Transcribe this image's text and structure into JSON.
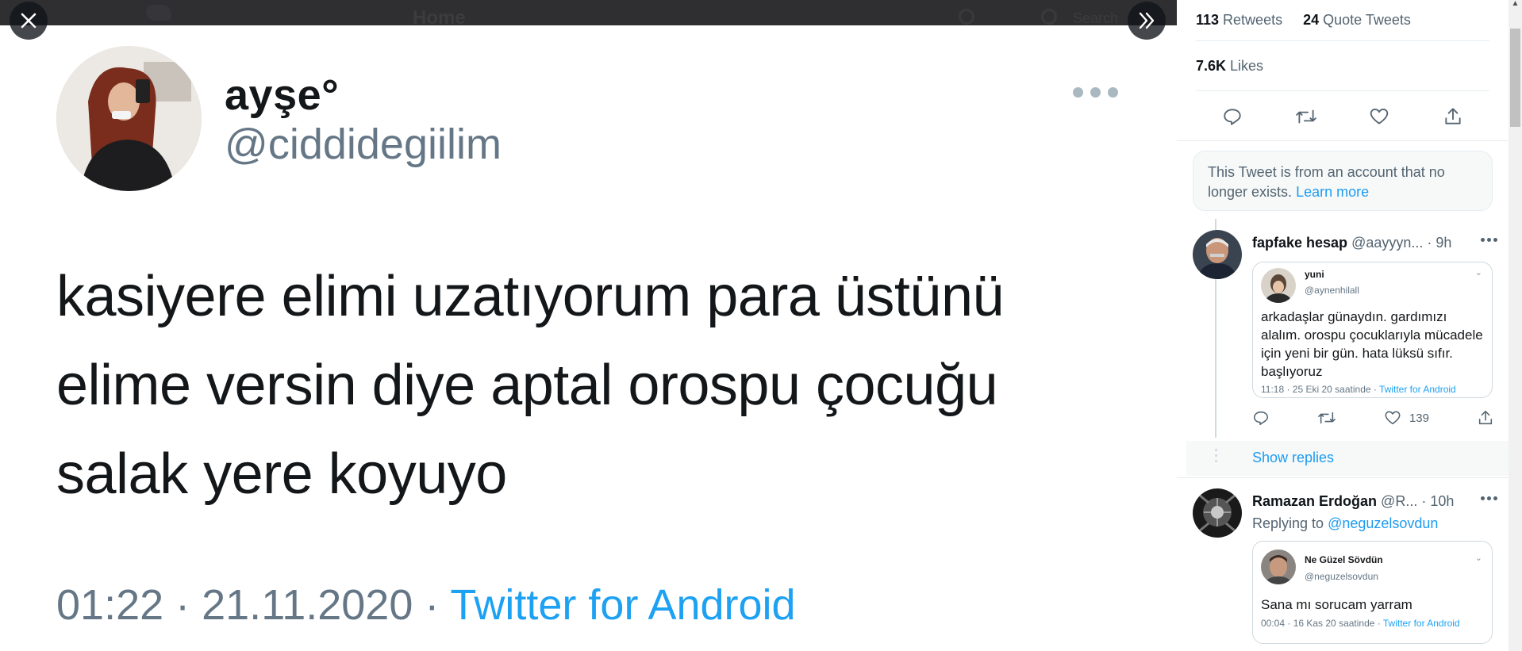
{
  "viewer": {
    "topbar_title": "Home",
    "topbar_search": "Search",
    "author_name": "ayşe°",
    "author_handle": "@ciddidegiilim",
    "tweet_lines": [
      "kasiyere elimi uzatıyorum para üstünü",
      "elime versin diye aptal orospu çocuğu",
      "salak yere koyuyo"
    ],
    "meta_time": "01:22 · 21.11.2020 · ",
    "meta_source": "Twitter for Android"
  },
  "stats": {
    "retweets_count": "113",
    "retweets_label": "Retweets",
    "quotes_count": "24",
    "quotes_label": "Quote Tweets",
    "likes_count": "7.6K",
    "likes_label": "Likes"
  },
  "notice": {
    "text": "This Tweet is from an account that no longer exists. ",
    "link": "Learn more"
  },
  "replies": [
    {
      "name": "fapfake hesap",
      "handle_time": " @aayyyn... · 9h",
      "embed": {
        "name": "yuni",
        "handle": "@aynenhilall",
        "text": "arkadaşlar günaydın. gardımızı alalım. orospu çocuklarıyla mücadele için yeni bir gün. hata lüksü sıfır. başlıyoruz",
        "meta_time": "11:18 · 25 Eki 20 saatinde · ",
        "meta_source": "Twitter for Android"
      },
      "like_count": "139"
    },
    {
      "name": "Ramazan Erdoğan",
      "handle_time": " @R... · 10h",
      "replying_prefix": "Replying to ",
      "replying_handle": "@neguzelsovdun",
      "embed": {
        "name": "Ne Güzel Sövdün",
        "handle": "@neguzelsovdun",
        "text": "Sana mı sorucam yarram",
        "meta_time": "00:04 · 16 Kas 20 saatinde · ",
        "meta_source": "Twitter for Android"
      }
    }
  ],
  "show_replies": "Show replies",
  "colors": {
    "accent": "#1d9bf0",
    "text_primary": "#0f1419",
    "text_secondary": "#536471",
    "border": "#e6ecf0"
  },
  "icons": [
    "close-icon",
    "expand-panel-icon",
    "more-icon",
    "reply-icon",
    "retweet-icon",
    "like-icon",
    "share-icon",
    "chevron-down-icon"
  ]
}
